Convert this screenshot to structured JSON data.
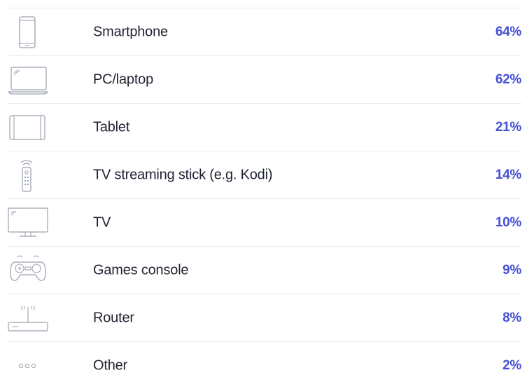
{
  "chart_data": {
    "type": "table",
    "categories": [
      "Smartphone",
      "PC/laptop",
      "Tablet",
      "TV streaming stick (e.g. Kodi)",
      "TV",
      "Games console",
      "Router",
      "Other"
    ],
    "values": [
      64,
      62,
      21,
      14,
      10,
      9,
      8,
      2
    ],
    "value_labels": [
      "64%",
      "62%",
      "21%",
      "14%",
      "10%",
      "9%",
      "8%",
      "2%"
    ],
    "icons": [
      "smartphone-icon",
      "laptop-icon",
      "tablet-icon",
      "remote-icon",
      "tv-icon",
      "gamepad-icon",
      "router-icon",
      "more-icon"
    ]
  },
  "colors": {
    "accent": "#4450d6",
    "text": "#1f2230",
    "icon": "#9aa0ad",
    "divider": "#e6eaf2"
  }
}
